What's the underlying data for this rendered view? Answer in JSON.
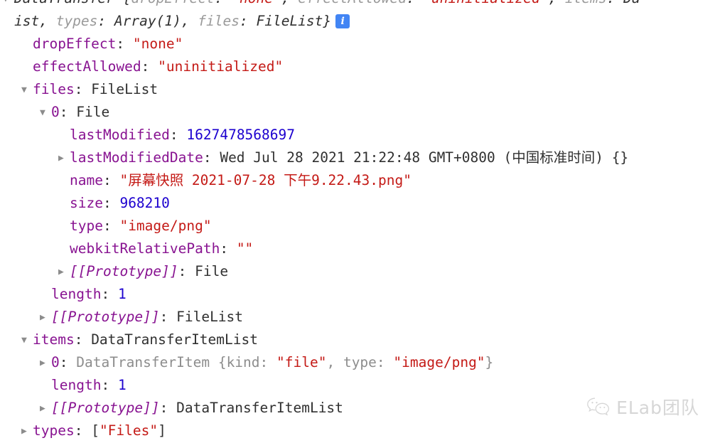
{
  "console": {
    "rows": [
      {
        "id": "datatransfer-preview-line1",
        "indent": 0,
        "triangle": "open",
        "style": "preview",
        "tokens": [
          {
            "t": "DataTransfer {",
            "c": "plain"
          },
          {
            "t": "dropEffect",
            "c": "grey"
          },
          {
            "t": ": ",
            "c": "plain"
          },
          {
            "t": "\"none\"",
            "c": "str"
          },
          {
            "t": ", ",
            "c": "plain"
          },
          {
            "t": "effectAllowed",
            "c": "grey"
          },
          {
            "t": ": ",
            "c": "plain"
          },
          {
            "t": "\"uninitialized\"",
            "c": "str"
          },
          {
            "t": ", ",
            "c": "plain"
          },
          {
            "t": "items",
            "c": "grey"
          },
          {
            "t": ": ",
            "c": "plain"
          },
          {
            "t": "Da",
            "c": "plain"
          }
        ]
      },
      {
        "id": "datatransfer-preview-line2",
        "indent": 0,
        "triangle": "none",
        "style": "preview",
        "tokens": [
          {
            "t": "ist, ",
            "c": "plain"
          },
          {
            "t": "types",
            "c": "grey"
          },
          {
            "t": ": ",
            "c": "plain"
          },
          {
            "t": "Array(1)",
            "c": "plain"
          },
          {
            "t": ", ",
            "c": "plain"
          },
          {
            "t": "files",
            "c": "grey"
          },
          {
            "t": ": ",
            "c": "plain"
          },
          {
            "t": "FileList}",
            "c": "plain"
          }
        ],
        "badge": "i"
      },
      {
        "id": "row-dropeffect",
        "indent": 1,
        "triangle": "none",
        "tokens": [
          {
            "t": "dropEffect",
            "c": "prop"
          },
          {
            "t": ": ",
            "c": "punct"
          },
          {
            "t": "\"none\"",
            "c": "str"
          }
        ]
      },
      {
        "id": "row-effectallowed",
        "indent": 1,
        "triangle": "none",
        "tokens": [
          {
            "t": "effectAllowed",
            "c": "prop"
          },
          {
            "t": ": ",
            "c": "punct"
          },
          {
            "t": "\"uninitialized\"",
            "c": "str"
          }
        ]
      },
      {
        "id": "row-files",
        "indent": 1,
        "triangle": "open",
        "tokens": [
          {
            "t": "files",
            "c": "prop"
          },
          {
            "t": ": ",
            "c": "punct"
          },
          {
            "t": "FileList",
            "c": "plain"
          }
        ]
      },
      {
        "id": "row-files-0",
        "indent": 2,
        "triangle": "open",
        "tokens": [
          {
            "t": "0",
            "c": "prop"
          },
          {
            "t": ": ",
            "c": "punct"
          },
          {
            "t": "File",
            "c": "plain"
          }
        ]
      },
      {
        "id": "row-lastmodified",
        "indent": 3,
        "triangle": "none",
        "tokens": [
          {
            "t": "lastModified",
            "c": "prop"
          },
          {
            "t": ": ",
            "c": "punct"
          },
          {
            "t": "1627478568697",
            "c": "num"
          }
        ]
      },
      {
        "id": "row-lastmodifieddate",
        "indent": 3,
        "triangle": "closed",
        "tokens": [
          {
            "t": "lastModifiedDate",
            "c": "prop"
          },
          {
            "t": ": ",
            "c": "punct"
          },
          {
            "t": "Wed Jul 28 2021 21:22:48 GMT+0800 (中国标准时间) {}",
            "c": "plain"
          }
        ]
      },
      {
        "id": "row-name",
        "indent": 3,
        "triangle": "none",
        "tokens": [
          {
            "t": "name",
            "c": "prop"
          },
          {
            "t": ": ",
            "c": "punct"
          },
          {
            "t": "\"屏幕快照 2021-07-28 下午9.22.43.png\"",
            "c": "str"
          }
        ]
      },
      {
        "id": "row-size",
        "indent": 3,
        "triangle": "none",
        "tokens": [
          {
            "t": "size",
            "c": "prop"
          },
          {
            "t": ": ",
            "c": "punct"
          },
          {
            "t": "968210",
            "c": "num"
          }
        ]
      },
      {
        "id": "row-type",
        "indent": 3,
        "triangle": "none",
        "tokens": [
          {
            "t": "type",
            "c": "prop"
          },
          {
            "t": ": ",
            "c": "punct"
          },
          {
            "t": "\"image/png\"",
            "c": "str"
          }
        ]
      },
      {
        "id": "row-webkitrelativepath",
        "indent": 3,
        "triangle": "none",
        "tokens": [
          {
            "t": "webkitRelativePath",
            "c": "prop"
          },
          {
            "t": ": ",
            "c": "punct"
          },
          {
            "t": "\"\"",
            "c": "str"
          }
        ]
      },
      {
        "id": "row-file-prototype",
        "indent": 3,
        "triangle": "closed",
        "tokens": [
          {
            "t": "[[Prototype]]",
            "c": "proto"
          },
          {
            "t": ": ",
            "c": "punct"
          },
          {
            "t": "File",
            "c": "plain"
          }
        ]
      },
      {
        "id": "row-filelist-length",
        "indent": 2,
        "triangle": "none",
        "tokens": [
          {
            "t": "length",
            "c": "prop"
          },
          {
            "t": ": ",
            "c": "punct"
          },
          {
            "t": "1",
            "c": "num"
          }
        ]
      },
      {
        "id": "row-filelist-prototype",
        "indent": 2,
        "triangle": "closed",
        "tokens": [
          {
            "t": "[[Prototype]]",
            "c": "proto"
          },
          {
            "t": ": ",
            "c": "punct"
          },
          {
            "t": "FileList",
            "c": "plain"
          }
        ]
      },
      {
        "id": "row-items",
        "indent": 1,
        "triangle": "open",
        "tokens": [
          {
            "t": "items",
            "c": "prop"
          },
          {
            "t": ": ",
            "c": "punct"
          },
          {
            "t": "DataTransferItemList",
            "c": "plain"
          }
        ]
      },
      {
        "id": "row-items-0",
        "indent": 2,
        "triangle": "closed",
        "tokens": [
          {
            "t": "0",
            "c": "prop"
          },
          {
            "t": ": ",
            "c": "punct"
          },
          {
            "t": "DataTransferItem {",
            "c": "grey"
          },
          {
            "t": "kind",
            "c": "grey"
          },
          {
            "t": ": ",
            "c": "grey"
          },
          {
            "t": "\"file\"",
            "c": "str"
          },
          {
            "t": ", ",
            "c": "grey"
          },
          {
            "t": "type",
            "c": "grey"
          },
          {
            "t": ": ",
            "c": "grey"
          },
          {
            "t": "\"image/png\"",
            "c": "str"
          },
          {
            "t": "}",
            "c": "grey"
          }
        ]
      },
      {
        "id": "row-items-length",
        "indent": 2,
        "triangle": "none",
        "tokens": [
          {
            "t": "length",
            "c": "prop"
          },
          {
            "t": ": ",
            "c": "punct"
          },
          {
            "t": "1",
            "c": "num"
          }
        ]
      },
      {
        "id": "row-items-prototype",
        "indent": 2,
        "triangle": "closed",
        "tokens": [
          {
            "t": "[[Prototype]]",
            "c": "proto"
          },
          {
            "t": ": ",
            "c": "punct"
          },
          {
            "t": "DataTransferItemList",
            "c": "plain"
          }
        ]
      },
      {
        "id": "row-types",
        "indent": 1,
        "triangle": "closed",
        "tokens": [
          {
            "t": "types",
            "c": "prop"
          },
          {
            "t": ": ",
            "c": "punct"
          },
          {
            "t": "[",
            "c": "punct"
          },
          {
            "t": "\"Files\"",
            "c": "str"
          },
          {
            "t": "]",
            "c": "punct"
          }
        ]
      }
    ]
  },
  "watermark": {
    "text": "ELab团队",
    "icon": "wechat-icon"
  },
  "colors": {
    "property": "#881391",
    "string": "#c41a16",
    "number": "#1c00cf",
    "plain": "#303030",
    "dim": "#8d8d8d",
    "badge_bg": "#4285f4",
    "background": "#ffffff"
  }
}
